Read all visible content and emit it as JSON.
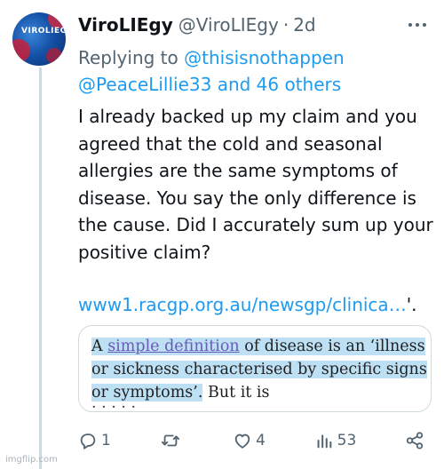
{
  "author": {
    "name": "ViroLIEgy",
    "handle": "@ViroLIEgy",
    "separator": "·",
    "time": "2d",
    "avatar_label": "VIROLIEGY"
  },
  "reply": {
    "prefix": "Replying to",
    "line1_mention": "@thisisnothappen",
    "line2_mentions": "@PeaceLillie33 and 46 others"
  },
  "tweet": {
    "text": "I already backed up my claim and you agreed that the cold and seasonal allergies are the same symptoms of disease. You say the only difference is the cause. Did I accurately sum up your positive claim?",
    "url": "www1.racgp.org.au/newsgp/clinica…",
    "url_tail": "'."
  },
  "card": {
    "text_prefix": "A ",
    "link": "simple definition",
    "text_mid": " of disease is an ‘illness or sickness characterised by specific signs or symptoms’.",
    "text_after": " But it is",
    "text_cut": "   ·  ·     ·    ·  ·"
  },
  "actions": {
    "reply_count": "1",
    "retweet_count": "",
    "like_count": "4",
    "views_count": "53"
  },
  "watermark": "imgflip.com",
  "colors": {
    "link": "#1d9bf0",
    "secondary": "#536471",
    "highlight": "#bde0f5"
  },
  "icons": [
    "more-icon",
    "reply-icon",
    "retweet-icon",
    "like-icon",
    "views-icon",
    "share-icon"
  ]
}
